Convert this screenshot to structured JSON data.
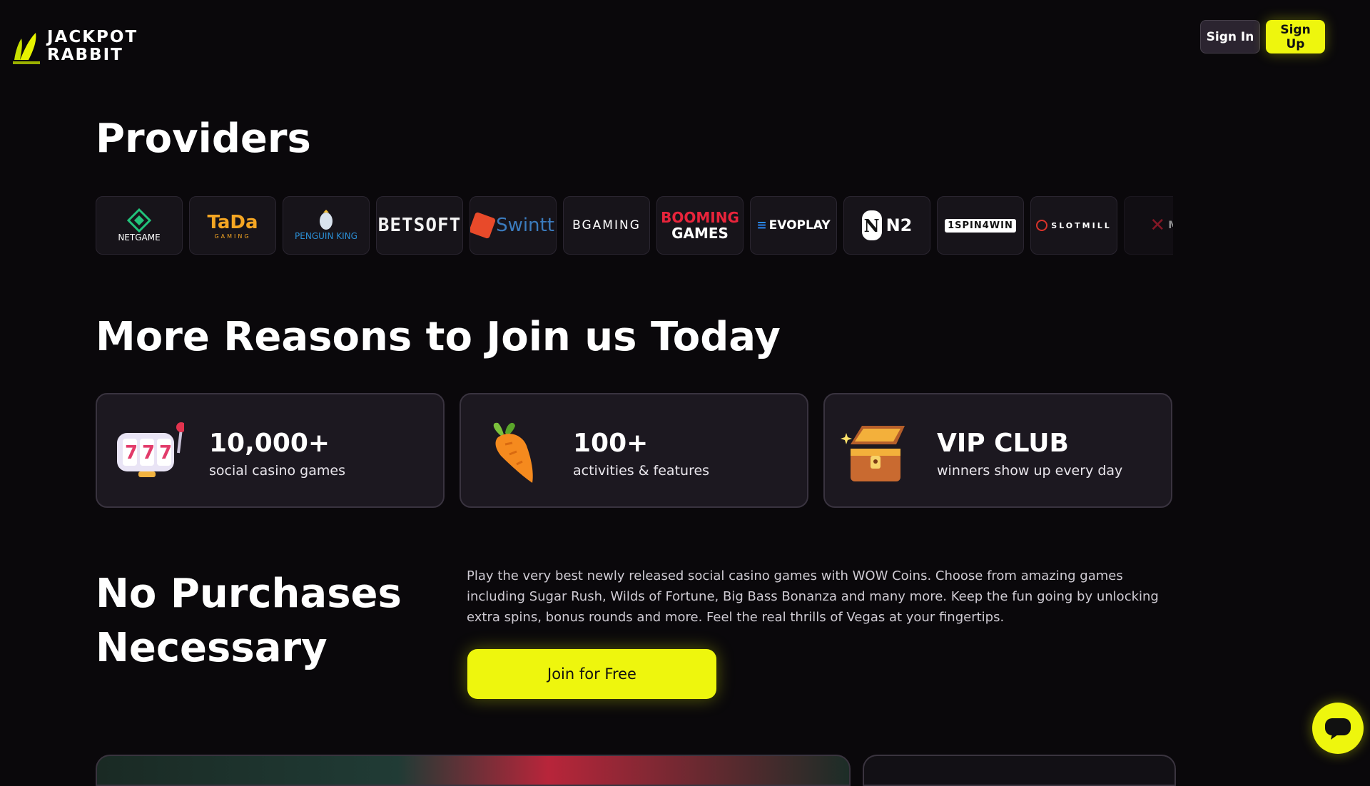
{
  "header": {
    "logo_line1": "JACKPOT",
    "logo_line2": "RABBIT",
    "sign_in": "Sign In",
    "sign_up": "Sign Up"
  },
  "providers": {
    "title": "Providers",
    "items": [
      {
        "name": "NETGAME"
      },
      {
        "name": "TaDa",
        "sub": "GAMING"
      },
      {
        "name": "PENGUIN KING"
      },
      {
        "name": "BETSOFT"
      },
      {
        "name": "Swintt"
      },
      {
        "name": "BGAMING"
      },
      {
        "name": "BOOMING",
        "sub": "GAMES"
      },
      {
        "name": "EVOPLAY"
      },
      {
        "name": "N2"
      },
      {
        "name": "1SPIN4WIN"
      },
      {
        "name": "SLOTMILL"
      },
      {
        "name": "Ma"
      }
    ]
  },
  "reasons": {
    "title": "More Reasons to Join us Today",
    "cards": [
      {
        "value": "10,000+",
        "caption": "social casino games",
        "icon": "slot-machine-icon"
      },
      {
        "value": "100+",
        "caption": "activities & features",
        "icon": "carrot-icon"
      },
      {
        "value": "VIP CLUB",
        "caption": "winners show up every day",
        "icon": "treasure-chest-icon"
      }
    ]
  },
  "no_purchase": {
    "title": "No Purchases Necessary",
    "description": "Play the very best newly released social casino games with WOW Coins. Choose from amazing games including Sugar Rush, Wilds of Fortune, Big Bass Bonanza and many more. Keep the fun going by unlocking extra spins, bonus rounds and more. Feel the real thrills of Vegas at your fingertips.",
    "cta": "Join for Free"
  },
  "colors": {
    "background": "#0a080b",
    "accent": "#eef60d",
    "card": "#1c1820"
  }
}
